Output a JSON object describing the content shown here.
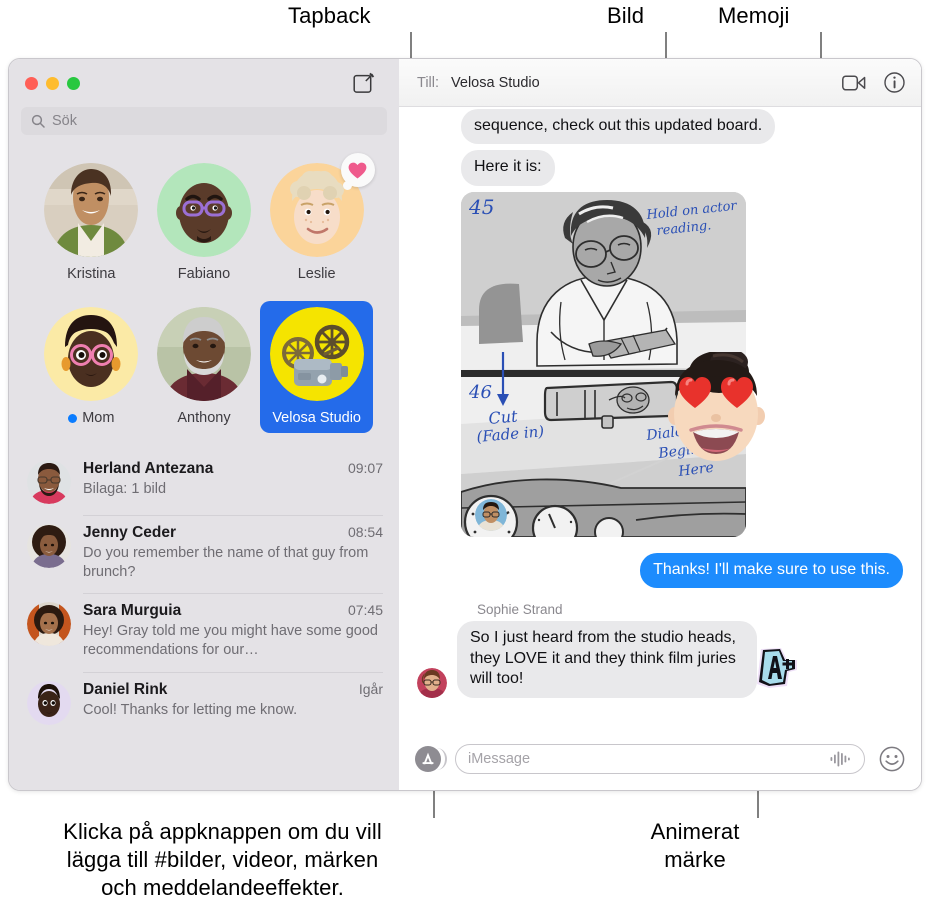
{
  "callouts": [
    {
      "name": "tapback",
      "label": "Tapback"
    },
    {
      "name": "bild",
      "label": "Bild"
    },
    {
      "name": "memoji",
      "label": "Memoji"
    },
    {
      "name": "app-button",
      "label": "Klicka på appknappen om du vill\nlägga till #bilder, videor, märken\noch meddelandeeffekter."
    },
    {
      "name": "animated-sticker",
      "label": "Animerat\nmärke"
    }
  ],
  "window": {
    "traffic_lights": [
      "close",
      "minimize",
      "zoom"
    ],
    "compose_icon": "compose-icon"
  },
  "sidebar": {
    "search": {
      "placeholder": "Sök",
      "icon": "search-icon"
    },
    "pinned": [
      {
        "name": "Kristina",
        "avatar": "photo-woman-smiling",
        "selected": false,
        "tapback": null,
        "unread": false
      },
      {
        "name": "Fabiano",
        "avatar": "memoji-bald-glasses",
        "selected": false,
        "tapback": null,
        "unread": false
      },
      {
        "name": "Leslie",
        "avatar": "memoji-blond-curly",
        "selected": false,
        "tapback": "heart-icon",
        "unread": false
      },
      {
        "name": "Mom",
        "avatar": "memoji-pink-glasses",
        "selected": false,
        "tapback": null,
        "unread": true
      },
      {
        "name": "Anthony",
        "avatar": "photo-man-grey-beard",
        "selected": false,
        "tapback": null,
        "unread": false
      },
      {
        "name": "Velosa Studio",
        "avatar": "film-projector-emoji",
        "selected": true,
        "tapback": null,
        "unread": false
      }
    ],
    "conversations": [
      {
        "name": "Herland Antezana",
        "time": "09:07",
        "snippet": "Bilaga:  1 bild",
        "avatar": "photo-man-beard-glasses"
      },
      {
        "name": "Jenny Ceder",
        "time": "08:54",
        "snippet": "Do you remember the name of that guy from brunch?",
        "avatar": "photo-woman-curly"
      },
      {
        "name": "Sara Murguia",
        "time": "07:45",
        "snippet": "Hey! Gray told me you might have some good recommendations for our…",
        "avatar": "photo-woman-bob"
      },
      {
        "name": "Daniel Rink",
        "time": "Igår",
        "snippet": "Cool! Thanks for letting me know.",
        "avatar": "memoji-dark-man"
      }
    ]
  },
  "chat": {
    "to_label": "Till:",
    "to_value": "Velosa Studio",
    "actions": [
      {
        "name": "facetime-video-icon"
      },
      {
        "name": "info-icon"
      }
    ],
    "messages": [
      {
        "type": "incoming-text",
        "text": "sequence, check out this updated board."
      },
      {
        "type": "incoming-text",
        "text": "Here it is:"
      },
      {
        "type": "incoming-image",
        "name": "storyboard-image",
        "annotations": {
          "panel_top": "45",
          "panel_bottom": "46",
          "note_top_right": "Hold on actor reading.",
          "note_cut": "Cut\n(Fade in)",
          "note_dialog": "Dialog Begins Here"
        },
        "overlay_sticker": "memoji-heart-eyes"
      },
      {
        "type": "outgoing-text",
        "text": "Thanks! I'll make sure to use this."
      },
      {
        "type": "incoming-text",
        "sender": "Sophie Strand",
        "text": "So I just heard from the studio heads, they LOVE it and they think film juries will too!",
        "overlay_sticker": "animated-A-plus-sticker"
      }
    ],
    "input": {
      "app_button": "app-store-icon",
      "placeholder": "iMessage",
      "audio_icon": "audio-waveform-icon",
      "emoji_icon": "emoji-smiley-icon"
    }
  },
  "colors": {
    "accent_blue": "#1d8cfd",
    "selected_blue": "#246bea",
    "sidebar_bg": "#e4e2e6",
    "bubble_in": "#e9e9eb",
    "unread_dot": "#0a7cff",
    "tapback_heart": "#ef5a8c"
  }
}
